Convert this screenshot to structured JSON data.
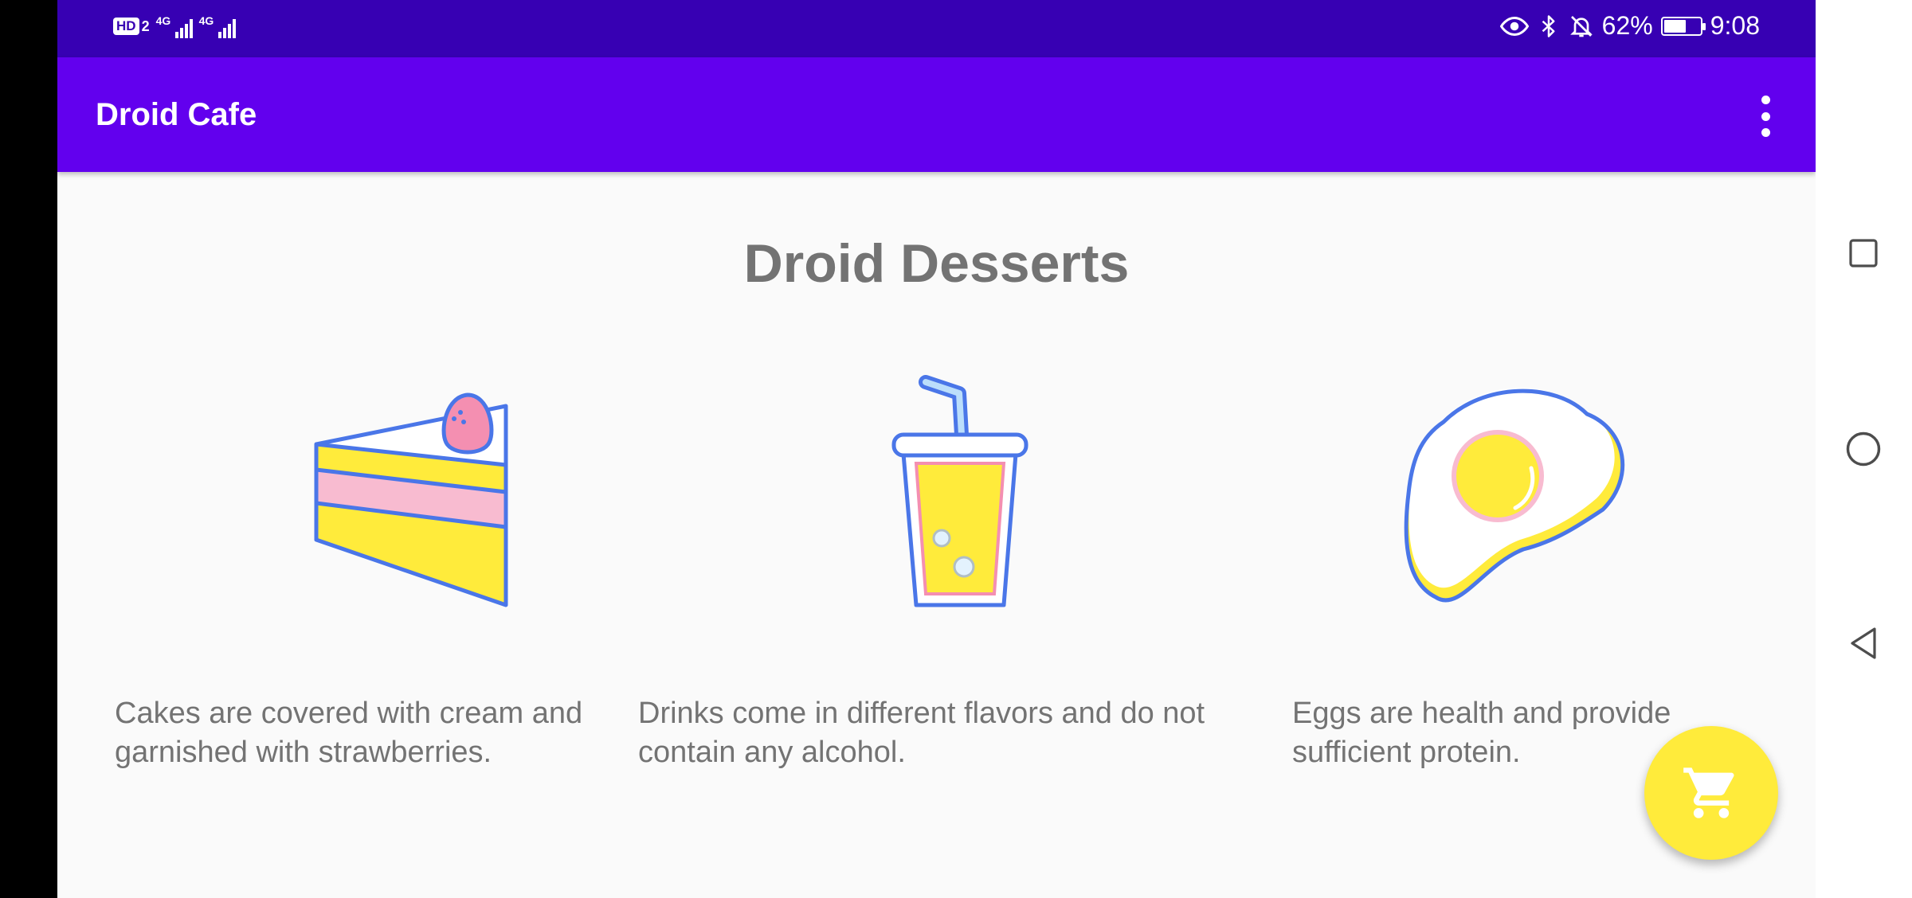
{
  "status_bar": {
    "hd_label": "HD",
    "sim_label": "2",
    "network_1": "4G",
    "network_2": "4G",
    "battery_percent": "62%",
    "battery_level": 0.62,
    "time": "9:08"
  },
  "app_bar": {
    "title": "Droid Cafe",
    "menu_icon": "more-vert-icon"
  },
  "main": {
    "heading": "Droid Desserts",
    "items": [
      {
        "icon": "cake-icon",
        "description": "Cakes are covered with cream and garnished with strawberries."
      },
      {
        "icon": "drink-icon",
        "description": "Drinks come in different flavors and do not contain any alcohol."
      },
      {
        "icon": "egg-icon",
        "description": "Eggs are health and provide sufficient protein."
      }
    ]
  },
  "fab": {
    "icon": "shopping-cart-icon"
  },
  "navigation": {
    "recents_icon": "square-icon",
    "home_icon": "circle-icon",
    "back_icon": "triangle-back-icon"
  },
  "colors": {
    "status_bar": "#3700b3",
    "app_bar": "#6200ee",
    "background": "#fafafa",
    "text": "#737373",
    "fab": "#ffeb3b"
  }
}
